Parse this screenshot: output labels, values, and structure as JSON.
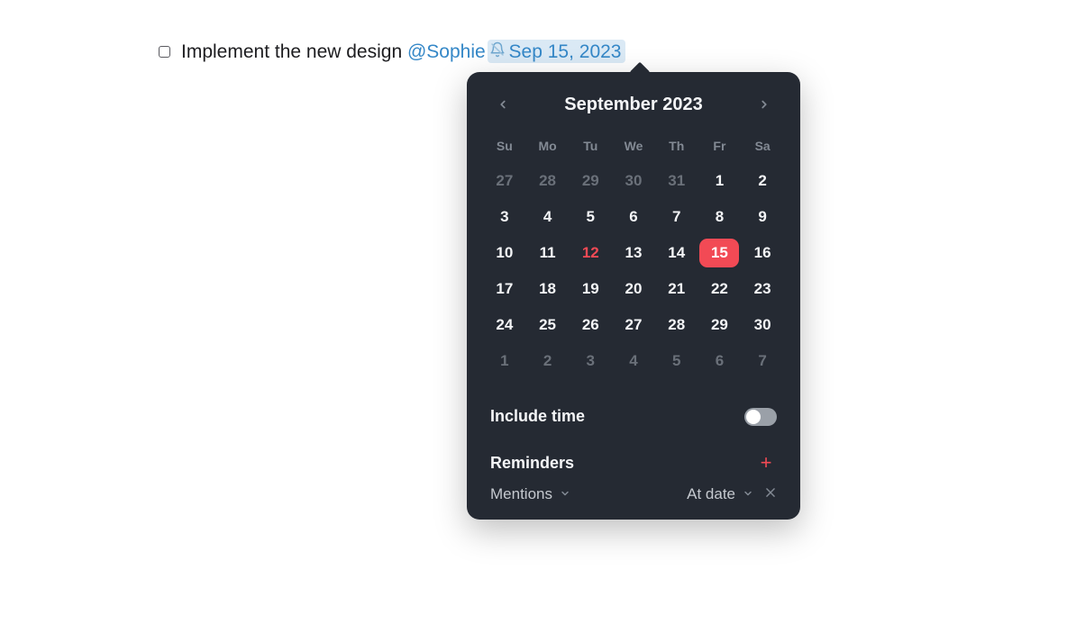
{
  "task": {
    "text": "Implement the new design",
    "mention": "@Sophie",
    "date_label": "Sep 15, 2023"
  },
  "calendar": {
    "title": "September 2023",
    "weekdays": [
      "Su",
      "Mo",
      "Tu",
      "We",
      "Th",
      "Fr",
      "Sa"
    ],
    "cells": [
      {
        "n": "27",
        "out": true
      },
      {
        "n": "28",
        "out": true
      },
      {
        "n": "29",
        "out": true
      },
      {
        "n": "30",
        "out": true
      },
      {
        "n": "31",
        "out": true
      },
      {
        "n": "1"
      },
      {
        "n": "2"
      },
      {
        "n": "3"
      },
      {
        "n": "4"
      },
      {
        "n": "5"
      },
      {
        "n": "6"
      },
      {
        "n": "7"
      },
      {
        "n": "8"
      },
      {
        "n": "9"
      },
      {
        "n": "10"
      },
      {
        "n": "11"
      },
      {
        "n": "12",
        "today": true
      },
      {
        "n": "13"
      },
      {
        "n": "14"
      },
      {
        "n": "15",
        "selected": true
      },
      {
        "n": "16"
      },
      {
        "n": "17"
      },
      {
        "n": "18"
      },
      {
        "n": "19"
      },
      {
        "n": "20"
      },
      {
        "n": "21"
      },
      {
        "n": "22"
      },
      {
        "n": "23"
      },
      {
        "n": "24"
      },
      {
        "n": "25"
      },
      {
        "n": "26"
      },
      {
        "n": "27"
      },
      {
        "n": "28"
      },
      {
        "n": "29"
      },
      {
        "n": "30"
      },
      {
        "n": "1",
        "out": true
      },
      {
        "n": "2",
        "out": true
      },
      {
        "n": "3",
        "out": true
      },
      {
        "n": "4",
        "out": true
      },
      {
        "n": "5",
        "out": true
      },
      {
        "n": "6",
        "out": true
      },
      {
        "n": "7",
        "out": true
      }
    ]
  },
  "include_time": {
    "label": "Include time",
    "enabled": false
  },
  "reminders": {
    "label": "Reminders",
    "items": [
      {
        "recipients": "Mentions",
        "timing": "At date"
      }
    ]
  }
}
